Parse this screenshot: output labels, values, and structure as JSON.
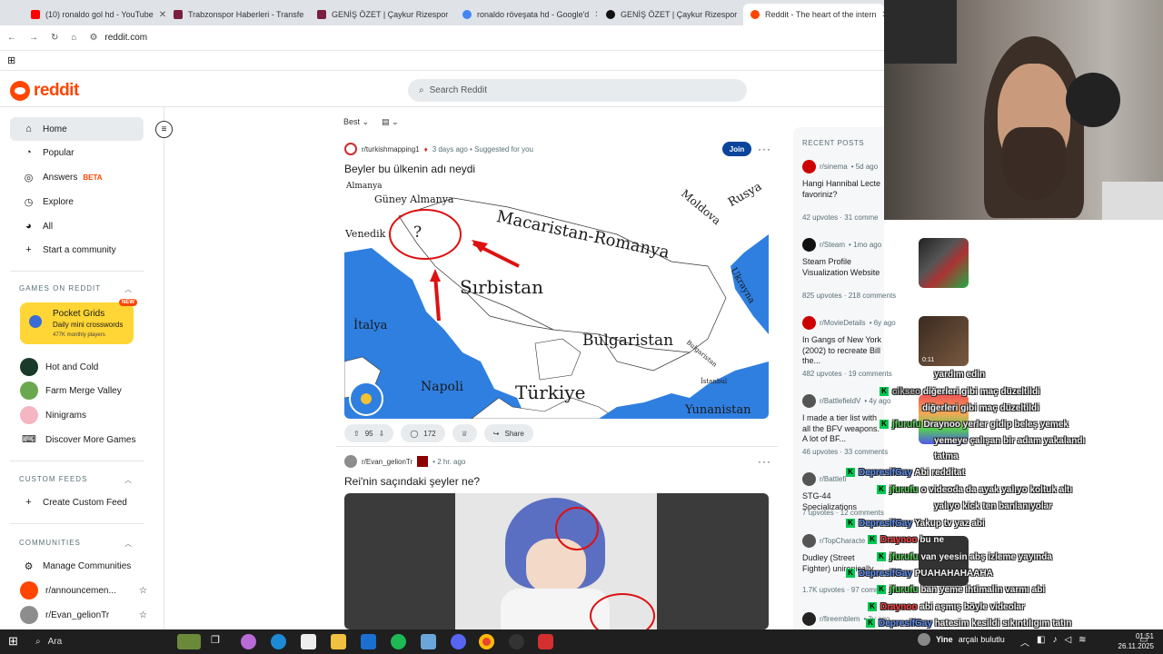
{
  "browser": {
    "tabs": [
      {
        "label": "(10) ronaldo gol hd - YouTube",
        "color": "#ff0000"
      },
      {
        "label": "Trabzonspor Haberleri - Transfe",
        "color": "#7a1f3d"
      },
      {
        "label": "GENİŞ ÖZET | Çaykur Rizespor",
        "color": "#7a1f3d"
      },
      {
        "label": "ronaldo röveşata hd - Google'd",
        "color": "#4285f4"
      },
      {
        "label": "GENİŞ ÖZET | Çaykur Rizespor",
        "color": "#111111"
      },
      {
        "label": "Reddit - The heart of the intern",
        "color": "#ff4500"
      }
    ],
    "url": "reddit.com"
  },
  "header": {
    "logo_text": "reddit",
    "search_placeholder": "Search Reddit"
  },
  "sidebar": {
    "nav": [
      {
        "label": "Home",
        "icon": "home-icon"
      },
      {
        "label": "Popular",
        "icon": "popular-icon"
      },
      {
        "label": "Answers",
        "icon": "answers-icon",
        "badge": "BETA"
      },
      {
        "label": "Explore",
        "icon": "explore-icon"
      },
      {
        "label": "All",
        "icon": "all-icon"
      },
      {
        "label": "Start a community",
        "icon": "plus-icon"
      }
    ],
    "games_title": "GAMES ON REDDIT",
    "pocket": {
      "title": "Pocket Grids",
      "subtitle": "Daily mini crosswords",
      "players": "477K monthly players",
      "badge": "NEW"
    },
    "games": [
      {
        "label": "Hot and Cold"
      },
      {
        "label": "Farm Merge Valley"
      },
      {
        "label": "Ninigrams"
      },
      {
        "label": "Discover More Games"
      }
    ],
    "custom_feeds_title": "CUSTOM FEEDS",
    "create_feed": "Create Custom Feed",
    "communities_title": "COMMUNITIES",
    "manage": "Manage Communities",
    "communities": [
      {
        "label": "r/announcemen..."
      },
      {
        "label": "r/Evan_gelionTr"
      }
    ]
  },
  "feed": {
    "sort": "Best",
    "post1": {
      "sub": "r/turkishmapping1",
      "meta": "3 days ago • Suggested for you",
      "join": "Join",
      "title": "Beyler bu ülkenin adı neydi",
      "map_labels": {
        "almanya": "Almanya",
        "guney": "Güney Almanya",
        "venedik": "Venedik",
        "q": "?",
        "macar": "Macaristan-Romanya",
        "moldova": "Moldova",
        "rusya": "Rusya",
        "sirbistan": "Sırbistan",
        "italya": "İtalya",
        "bulgaristan": "Bulgaristan",
        "napoli": "Napoli",
        "turkiye": "Türkiye",
        "yunanistan": "Yunanistan",
        "bulgaristan_small": "Bulgaristan",
        "istanbul": "İstanbul",
        "ukrayna": "Ukrayna"
      },
      "votes": "95",
      "comments": "172",
      "share": "Share"
    },
    "post2": {
      "sub": "r/Evan_gelionTr",
      "meta": "• 2 hr. ago",
      "title": "Rei'nin saçındaki şeyler ne?"
    }
  },
  "recent": {
    "title": "RECENT POSTS",
    "posts": [
      {
        "sub": "r/sinema",
        "age": "• 5d ago",
        "title": "Hangi Hannibal Lecte favoriniz?",
        "stats": "42 upvotes · 31 comme"
      },
      {
        "sub": "r/Steam",
        "age": "• 1mo ago",
        "title": "Steam Profile Visualization Website",
        "stats": "825 upvotes · 218 comments"
      },
      {
        "sub": "r/MovieDetails",
        "age": "• 6y ago",
        "title": "In Gangs of New York (2002) to recreate Bill the...",
        "stats": "482 upvotes · 19 comments",
        "duration": "0:11"
      },
      {
        "sub": "r/BattlefieldV",
        "age": "• 4y ago",
        "title": "I made a tier list with all the BFV weapons. A lot of BF...",
        "stats": "46 upvotes · 33 comments"
      },
      {
        "sub": "r/Battlefi",
        "age": "",
        "title": "STG-44 Specializations",
        "stats": "7 upvotes · 12 comments"
      },
      {
        "sub": "r/TopCharacte",
        "age": "",
        "title": "Dudley (Street Fighter) unironically",
        "stats": "1.7K upvotes · 97 comm"
      },
      {
        "sub": "r/fireemblem",
        "age": "• 3y ago",
        "title": "",
        "stats": ""
      }
    ]
  },
  "chat": [
    {
      "name": "",
      "text": "yardım edin",
      "cls": "msg"
    },
    {
      "name": "cikseo",
      "text": "diğerleri gibi maç düzeltildi",
      "cls": "nm4"
    },
    {
      "name": "",
      "text": "diğerleri gibi maç düzeltildi",
      "cls": "msg"
    },
    {
      "name": "jfurufu",
      "text": "Draynoo yerler gidip beleş yemek",
      "cls": "nm2"
    },
    {
      "name": "",
      "text": "yemeye çalışan bir adam yakalandı",
      "cls": "msg"
    },
    {
      "name": "",
      "text": "tatma",
      "cls": "msg"
    },
    {
      "name": "DepresifGay",
      "text": "Abi redditat",
      "cls": "nm1"
    },
    {
      "name": "jfurufu",
      "text": "o videoda da ayak yalıyo koltuk altı",
      "cls": "nm2"
    },
    {
      "name": "",
      "text": "yalıyo kick ten banlanıyolar",
      "cls": "msg"
    },
    {
      "name": "DepresifGay",
      "text": "Yakup tv yaz abi",
      "cls": "nm1"
    },
    {
      "name": "Draynoo",
      "text": "bu ne",
      "cls": "nm3"
    },
    {
      "name": "jfurufu",
      "text": "van yeesin abş izleme yayında",
      "cls": "nm2"
    },
    {
      "name": "DepresifGay",
      "text": "PUAHAHAHAAHA",
      "cls": "nm1"
    },
    {
      "name": "jfurufu",
      "text": "ban yeme ihtimalin varmı abi",
      "cls": "nm2"
    },
    {
      "name": "Draynoo",
      "text": "abi aşmış böyle videolar",
      "cls": "nm3"
    },
    {
      "name": "DepresifGay",
      "text": "hatesim kesildi sıkıntılıgım tatın",
      "cls": "nm1"
    }
  ],
  "taskbar": {
    "search": "Ara",
    "weather": "Yine",
    "weather_sub": "arçalı bulutlu",
    "time": "01:51",
    "date": "26.11.2025"
  }
}
